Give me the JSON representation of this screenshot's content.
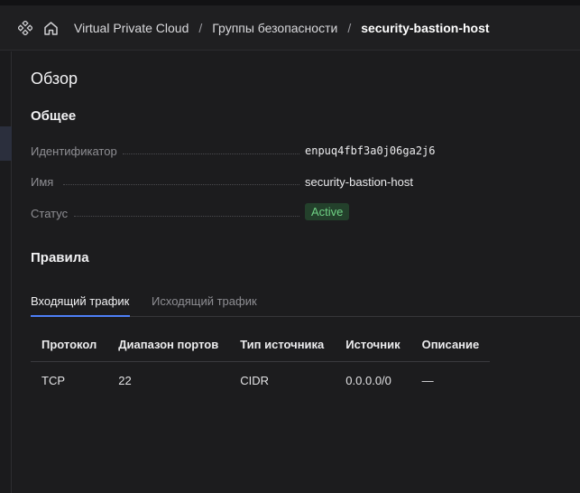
{
  "breadcrumb": {
    "items": [
      {
        "label": "Virtual Private Cloud"
      },
      {
        "label": "Группы безопасности"
      },
      {
        "label": "security-bastion-host"
      }
    ],
    "separator": "/"
  },
  "icons": {
    "services": "services-grid-icon",
    "home": "home-icon"
  },
  "overview": {
    "title": "Обзор",
    "general": {
      "title": "Общее",
      "fields": [
        {
          "label": "Идентификатор",
          "value": "enpuq4fbf3a0j06ga2j6"
        },
        {
          "label": "Имя",
          "value": "security-bastion-host"
        },
        {
          "label": "Статус",
          "value": "Active"
        }
      ]
    }
  },
  "rules": {
    "title": "Правила",
    "tabs": [
      {
        "label": "Входящий трафик",
        "active": true
      },
      {
        "label": "Исходящий трафик",
        "active": false
      }
    ],
    "columns": [
      "Протокол",
      "Диапазон портов",
      "Тип источника",
      "Источник",
      "Описание"
    ],
    "rows": [
      [
        "TCP",
        "22",
        "CIDR",
        "0.0.0.0/0",
        "—"
      ]
    ]
  },
  "colors": {
    "accent": "#4d7ff7",
    "status_active_bg": "#23402b",
    "status_active_text": "#6fd184",
    "background": "#1c1c1e"
  }
}
